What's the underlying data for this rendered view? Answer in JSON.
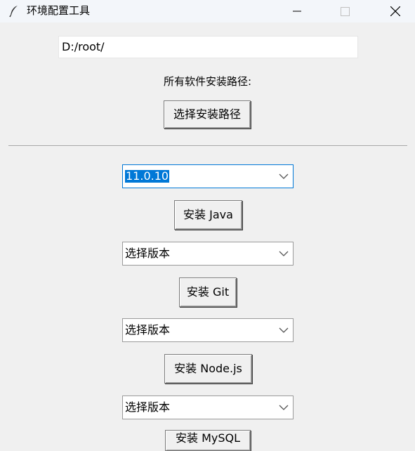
{
  "window": {
    "title": "环境配置工具",
    "icon": "feather-icon",
    "controls": [
      "minimize-icon",
      "maximize-icon",
      "close-icon"
    ]
  },
  "install_path": {
    "value": "D:/root/",
    "caption": "所有软件安装路径:",
    "choose_button": "选择安装路径"
  },
  "software": [
    {
      "name": "Java",
      "version": "11.0.10",
      "install_button": "安装 Java"
    },
    {
      "name": "Git",
      "version": "选择版本",
      "install_button": "安装 Git"
    },
    {
      "name": "Node.js",
      "version": "选择版本",
      "install_button": "安装 Node.js"
    },
    {
      "name": "MySQL",
      "version": "选择版本",
      "install_button": "安装 MySQL"
    }
  ],
  "colors": {
    "selection": "#0078d7",
    "background": "#f0f0f0"
  }
}
